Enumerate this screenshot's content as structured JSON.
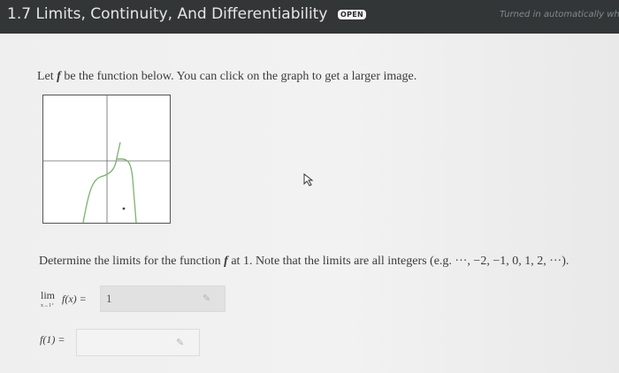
{
  "header": {
    "title": "1.7 Limits, Continuity, And Differentiability",
    "badge": "OPEN",
    "status": "Turned in automatically whe"
  },
  "problem": {
    "intro_prefix": "Let ",
    "intro_f": "f",
    "intro_suffix": " be the function below. You can click on the graph to get a larger image.",
    "determine_prefix": "Determine the limits for the function ",
    "determine_f": "f",
    "determine_suffix": " at 1. Note that the limits are all integers (e.g. ···, −2, −1, 0, 1, 2, ···)."
  },
  "limit": {
    "word": "lim",
    "subscript": "x→1⁺",
    "expression": "f(x) =",
    "value": "1"
  },
  "fvalue": {
    "label": "f(1) =",
    "value": ""
  },
  "icons": {
    "pencil": "pencil-icon",
    "cursor": "mouse-cursor-icon"
  },
  "colors": {
    "header_bg": "#333637",
    "graph_curve": "#7bb36e"
  }
}
